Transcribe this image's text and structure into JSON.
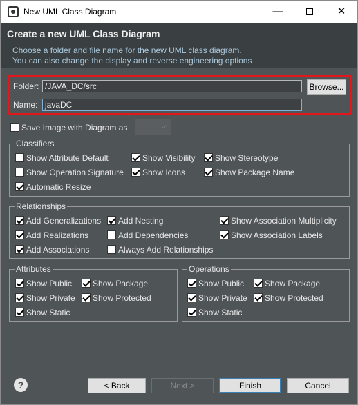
{
  "window": {
    "title": "New UML Class Diagram"
  },
  "banner": {
    "title": "Create a new UML Class Diagram",
    "desc_line1": "Choose a folder and file name for the new UML class diagram.",
    "desc_line2": "You can also change the display and reverse engineering options"
  },
  "location": {
    "folder_label": "Folder:",
    "folder_value": "/JAVA_DC/src",
    "browse_label": "Browse...",
    "name_label": "Name:",
    "name_value": "javaDC"
  },
  "save_image": {
    "label": "Save Image with Diagram as",
    "checked": false
  },
  "classifiers": {
    "title": "Classifiers",
    "items": [
      {
        "label": "Show Attribute Default",
        "checked": false
      },
      {
        "label": "Show Visibility",
        "checked": true
      },
      {
        "label": "Show Stereotype",
        "checked": true
      },
      {
        "label": "Show Operation Signature",
        "checked": false
      },
      {
        "label": "Show Icons",
        "checked": true
      },
      {
        "label": "Show Package Name",
        "checked": true
      },
      {
        "label": "Automatic Resize",
        "checked": true
      }
    ]
  },
  "relationships": {
    "title": "Relationships",
    "items": [
      {
        "label": "Add Generalizations",
        "checked": true
      },
      {
        "label": "Add Nesting",
        "checked": true
      },
      {
        "label": "Show Association Multiplicity",
        "checked": true
      },
      {
        "label": "Add Realizations",
        "checked": true
      },
      {
        "label": "Add Dependencies",
        "checked": false
      },
      {
        "label": "Show Association Labels",
        "checked": true
      },
      {
        "label": "Add Associations",
        "checked": true
      },
      {
        "label": "Always Add Relationships",
        "checked": false
      }
    ]
  },
  "attributes": {
    "title": "Attributes",
    "items": [
      {
        "label": "Show Public",
        "checked": true
      },
      {
        "label": "Show Package",
        "checked": true
      },
      {
        "label": "Show Private",
        "checked": true
      },
      {
        "label": "Show Protected",
        "checked": true
      },
      {
        "label": "Show Static",
        "checked": true
      }
    ]
  },
  "operations": {
    "title": "Operations",
    "items": [
      {
        "label": "Show Public",
        "checked": true
      },
      {
        "label": "Show Package",
        "checked": true
      },
      {
        "label": "Show Private",
        "checked": true
      },
      {
        "label": "Show Protected",
        "checked": true
      },
      {
        "label": "Show Static",
        "checked": true
      }
    ]
  },
  "footer": {
    "help_glyph": "?",
    "back_label": "< Back",
    "next_label": "Next >",
    "finish_label": "Finish",
    "cancel_label": "Cancel"
  },
  "colors": {
    "dialog_bg": "#4f5457",
    "highlight_border": "#e3161c",
    "banner_desc": "#a9c8dc"
  },
  "icons": {
    "minimize": "minimize-icon",
    "maximize": "maximize-icon",
    "close": "close-icon",
    "combo": "chevron-down-icon",
    "help": "help-icon"
  }
}
